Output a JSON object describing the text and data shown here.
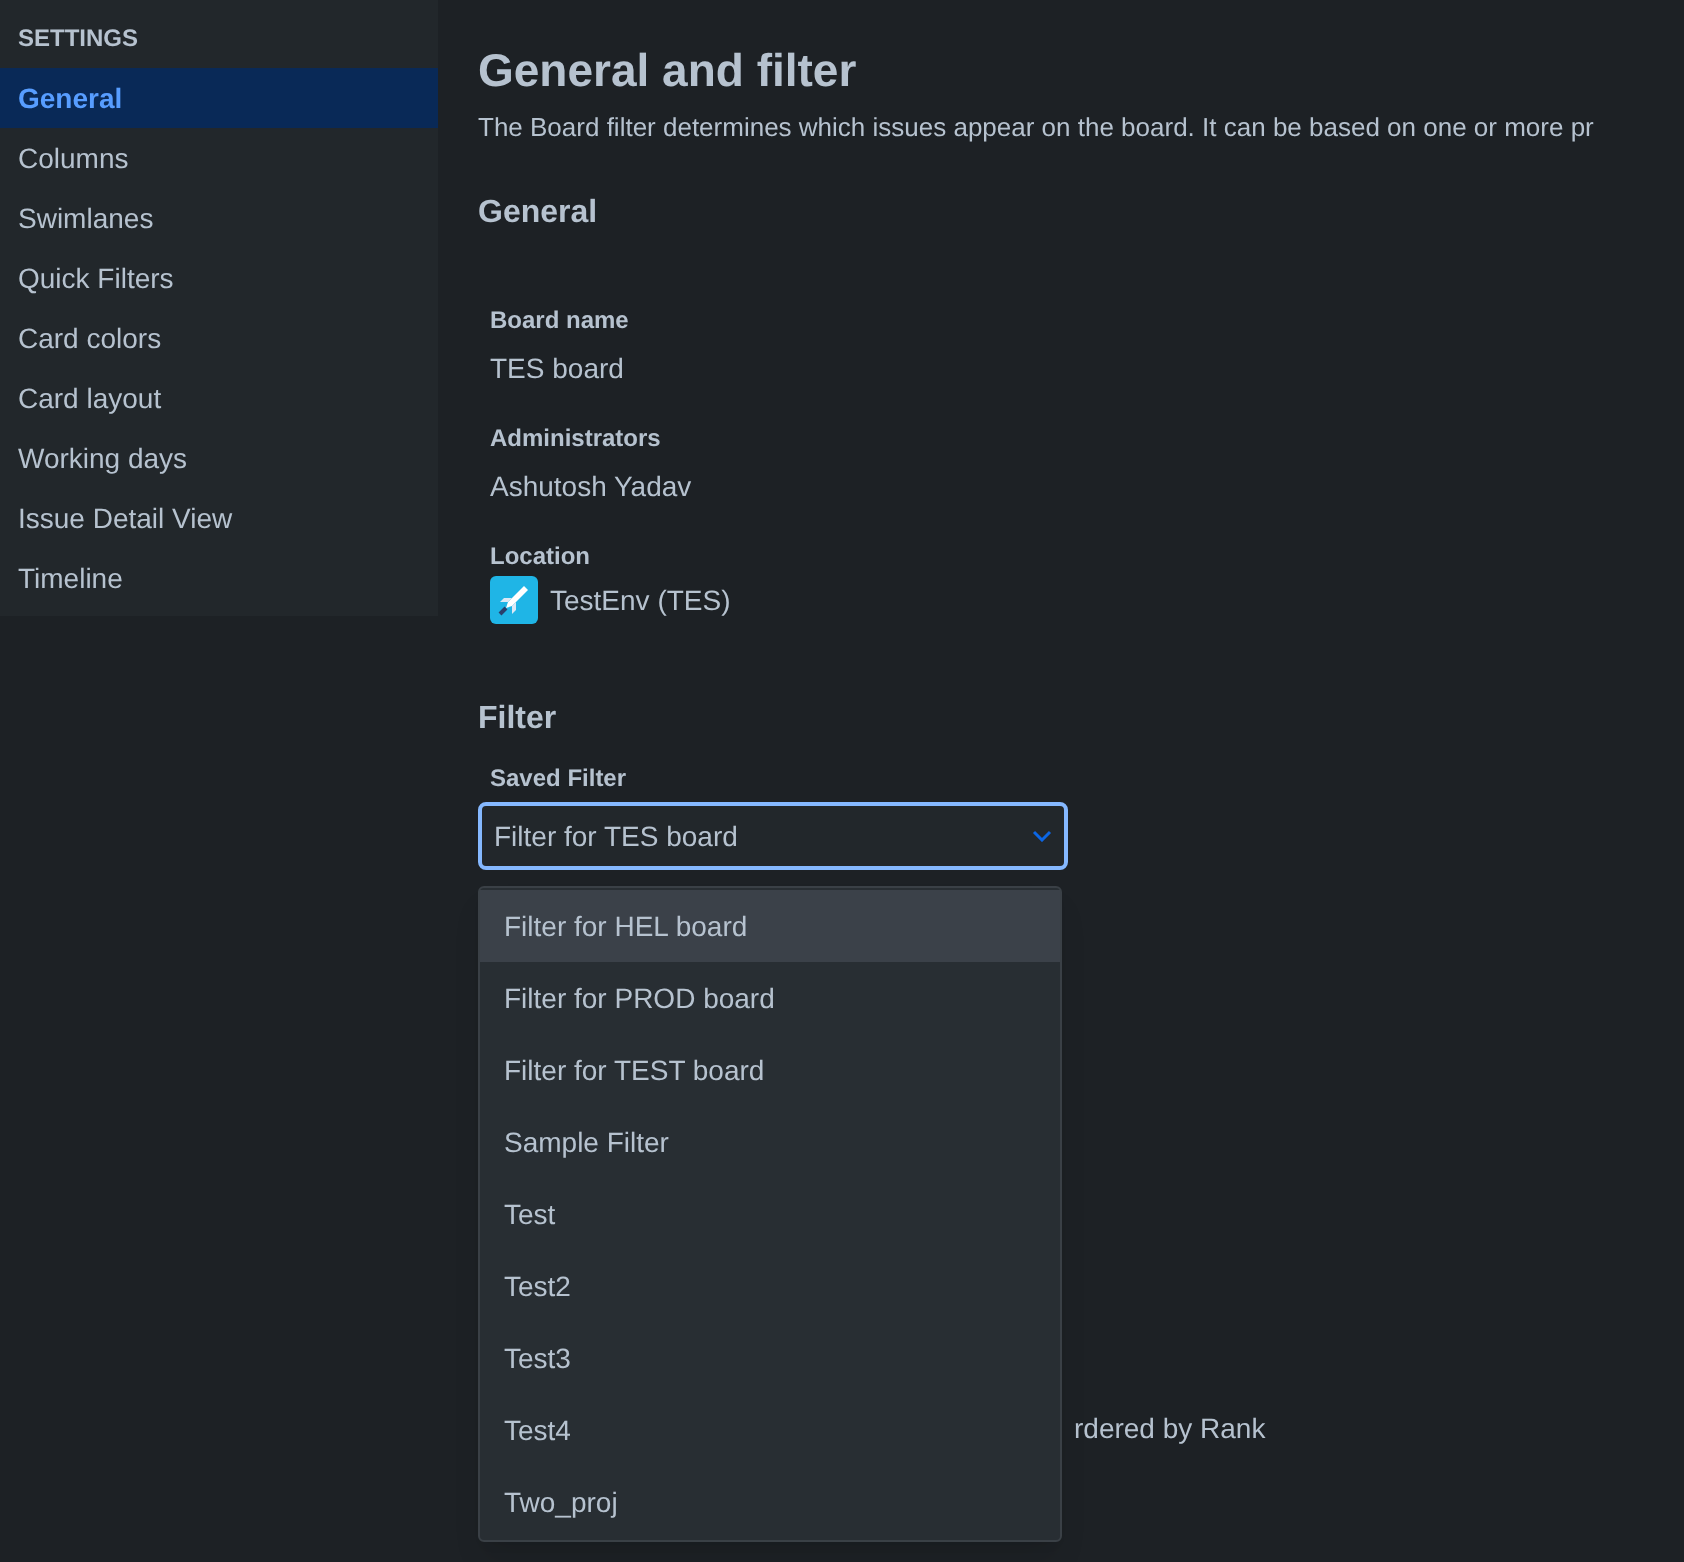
{
  "sidebar": {
    "heading": "SETTINGS",
    "items": [
      {
        "label": "General",
        "selected": true
      },
      {
        "label": "Columns",
        "selected": false
      },
      {
        "label": "Swimlanes",
        "selected": false
      },
      {
        "label": "Quick Filters",
        "selected": false
      },
      {
        "label": "Card colors",
        "selected": false
      },
      {
        "label": "Card layout",
        "selected": false
      },
      {
        "label": "Working days",
        "selected": false
      },
      {
        "label": "Issue Detail View",
        "selected": false
      },
      {
        "label": "Timeline",
        "selected": false
      }
    ]
  },
  "page": {
    "title": "General and filter",
    "description": "The Board filter determines which issues appear on the board. It can be based on one or more pr"
  },
  "general": {
    "heading": "General",
    "fields": [
      {
        "label": "Board name",
        "value": "TES board",
        "kind": "text"
      },
      {
        "label": "Administrators",
        "value": "Ashutosh Yadav",
        "kind": "text"
      },
      {
        "label": "Location",
        "value": "TestEnv (TES)",
        "kind": "project"
      }
    ]
  },
  "filter": {
    "heading": "Filter",
    "saved_filter": {
      "label": "Saved Filter",
      "value": "Filter for TES board",
      "expanded": true,
      "options": [
        {
          "label": "Filter for HEL board",
          "selected": true
        },
        {
          "label": "Filter for PROD board",
          "selected": false
        },
        {
          "label": "Filter for TEST board",
          "selected": false
        },
        {
          "label": "Sample Filter",
          "selected": false
        },
        {
          "label": "Test",
          "selected": false
        },
        {
          "label": "Test2",
          "selected": false
        },
        {
          "label": "Test3",
          "selected": false
        },
        {
          "label": "Test4",
          "selected": false
        },
        {
          "label": "Two_proj",
          "selected": false
        }
      ]
    },
    "ranking_note": "rdered by Rank"
  }
}
